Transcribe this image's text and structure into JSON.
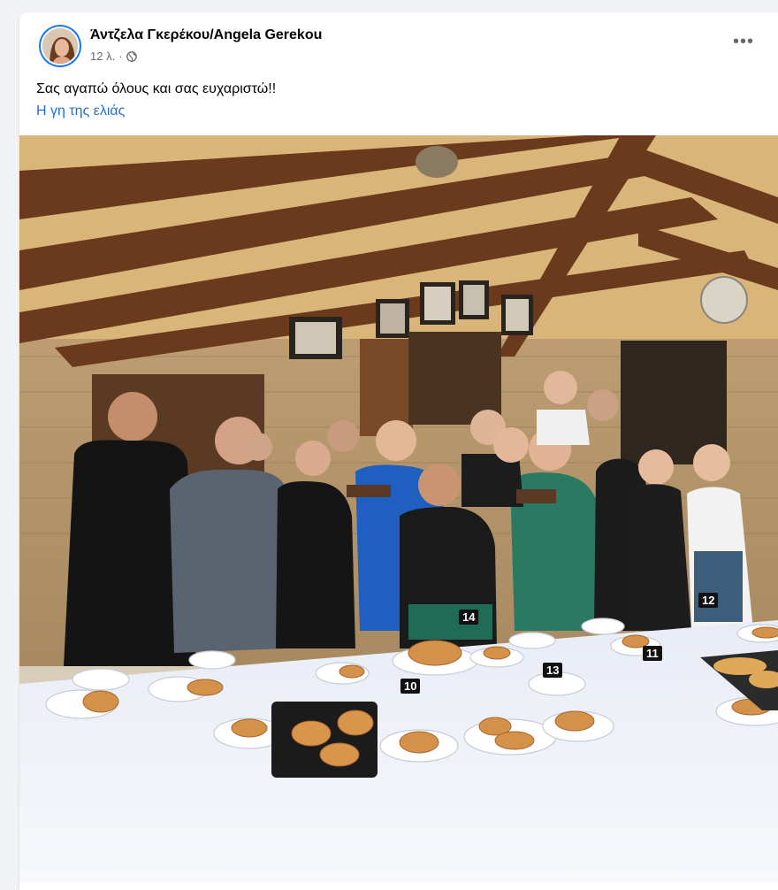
{
  "post": {
    "author": "Άντζελα Γκερέκου/Angela Gerekou",
    "time": "12 λ.",
    "separator": "·",
    "more_label": "•••",
    "text": "Σας αγαπώ όλους και σας ευχαριστώ!!",
    "link": "Η γη της ελιάς"
  },
  "photo": {
    "table_tags": [
      "10",
      "11",
      "13",
      "14",
      "12"
    ]
  },
  "colors": {
    "link": "#216fdb",
    "secondary_text": "#65676b",
    "page_background": "#f0f2f5"
  }
}
